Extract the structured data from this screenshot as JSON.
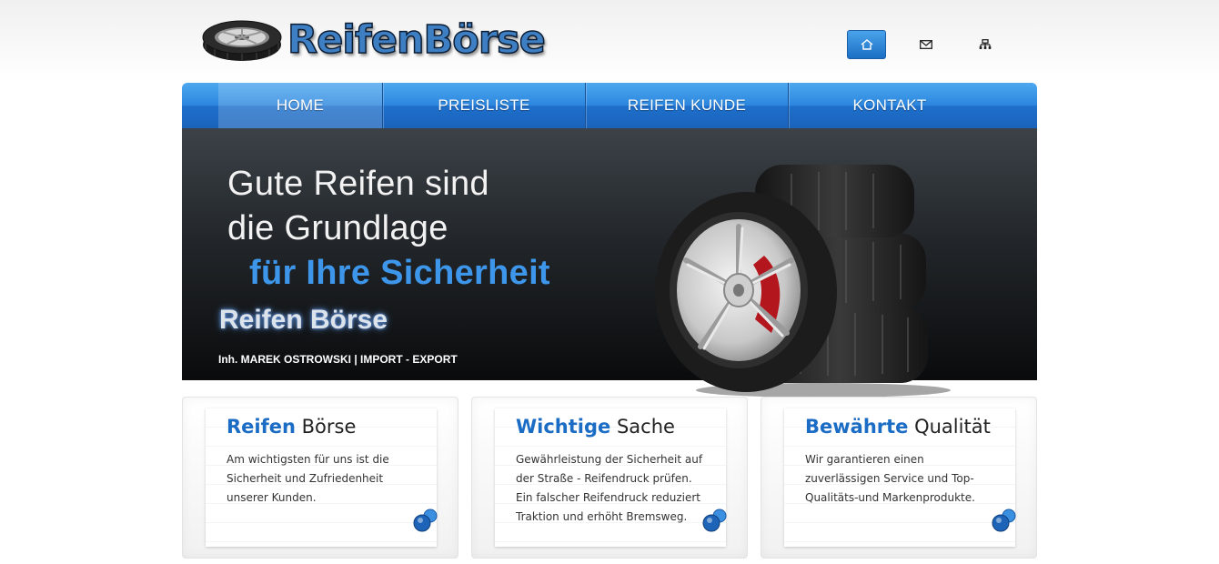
{
  "logo": {
    "text": "ReifenBörse"
  },
  "top_icons": [
    {
      "name": "home-icon",
      "active": true
    },
    {
      "name": "mail-icon",
      "active": false
    },
    {
      "name": "sitemap-icon",
      "active": false
    }
  ],
  "nav": {
    "items": [
      {
        "label": "HOME",
        "active": true
      },
      {
        "label": "PREISLISTE",
        "active": false
      },
      {
        "label": "REIFEN KUNDE",
        "active": false
      },
      {
        "label": "KONTAKT",
        "active": false
      }
    ]
  },
  "hero": {
    "line1": "Gute Reifen sind",
    "line2": "die Grundlage",
    "line3": "für Ihre Sicherheit",
    "brand": "Reifen Börse",
    "subline": "Inh. MAREK OSTROWSKI | IMPORT - EXPORT"
  },
  "cards": [
    {
      "title_highlight": "Reifen",
      "title_rest": " Börse",
      "text": "Am wichtigsten für uns ist die Sicherheit und Zufriedenheit unserer Kunden."
    },
    {
      "title_highlight": "Wichtige",
      "title_rest": " Sache",
      "text": "Gewährleistung der Sicherheit auf der Straße - Reifendruck prüfen. Ein falscher Reifendruck reduziert Traktion und erhöht Bremsweg."
    },
    {
      "title_highlight": "Bewährte",
      "title_rest": " Qualität",
      "text": "Wir garantieren einen zuverlässigen Service und Top-Qualitäts-und Markenprodukte."
    }
  ],
  "colors": {
    "accent": "#1b6cc4",
    "nav_blue": "#2c86de",
    "hero_highlight": "#3d96ea"
  }
}
